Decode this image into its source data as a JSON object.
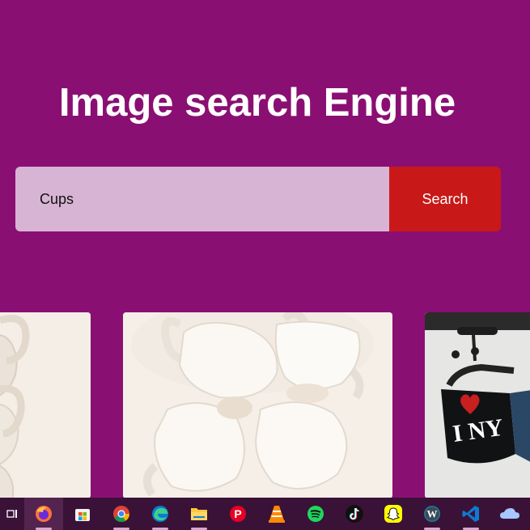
{
  "page": {
    "title": "Image search Engine"
  },
  "search": {
    "value": "Cups",
    "button_label": "Search"
  },
  "gallery": {
    "images": [
      {
        "subject": "white cups stacked (partial)"
      },
      {
        "subject": "handmade white ceramic cups"
      },
      {
        "subject": "black I love NY mug hanging"
      }
    ]
  },
  "taskbar": {
    "icons": [
      "task-view-icon",
      "firefox-icon",
      "microsoft-store-icon",
      "chrome-icon",
      "edge-icon",
      "file-explorer-icon",
      "pinterest-icon",
      "vlc-icon",
      "spotify-icon",
      "tiktok-icon",
      "snapchat-icon",
      "wordpress-icon",
      "vscode-icon",
      "onedrive-icon"
    ]
  },
  "colors": {
    "background": "#8a0f73",
    "input_background": "#d7b4d4",
    "button_background": "#c91818",
    "taskbar": "#3a1238"
  }
}
